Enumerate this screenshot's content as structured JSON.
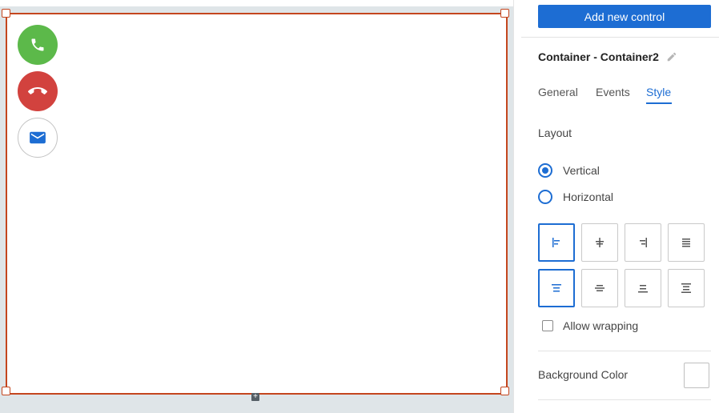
{
  "canvas": {
    "buttons": [
      {
        "icon": "phone-icon",
        "color": "#5cb94a"
      },
      {
        "icon": "hangup-icon",
        "color": "#d2423e"
      },
      {
        "icon": "mail-icon",
        "color": "#ffffff"
      }
    ],
    "selection_color": "#c4461e"
  },
  "panel": {
    "add_button_label": "Add new control",
    "title": "Container - Container2",
    "tabs": [
      {
        "label": "General",
        "active": false
      },
      {
        "label": "Events",
        "active": false
      },
      {
        "label": "Style",
        "active": true
      }
    ],
    "layout_label": "Layout",
    "layout_options": [
      {
        "label": "Vertical",
        "selected": true
      },
      {
        "label": "Horizontal",
        "selected": false
      }
    ],
    "alignment_buttons": [
      {
        "name": "align-left-top",
        "selected": true
      },
      {
        "name": "align-center-top",
        "selected": false
      },
      {
        "name": "align-right-top",
        "selected": false
      },
      {
        "name": "align-justify-top",
        "selected": false
      },
      {
        "name": "valign-top",
        "selected": true
      },
      {
        "name": "valign-middle",
        "selected": false
      },
      {
        "name": "valign-bottom",
        "selected": false
      },
      {
        "name": "valign-distribute",
        "selected": false
      }
    ],
    "allow_wrapping_label": "Allow wrapping",
    "allow_wrapping_checked": false,
    "background_color_label": "Background Color",
    "background_color_value": "#ffffff",
    "accent_color": "#1d6dd3"
  }
}
